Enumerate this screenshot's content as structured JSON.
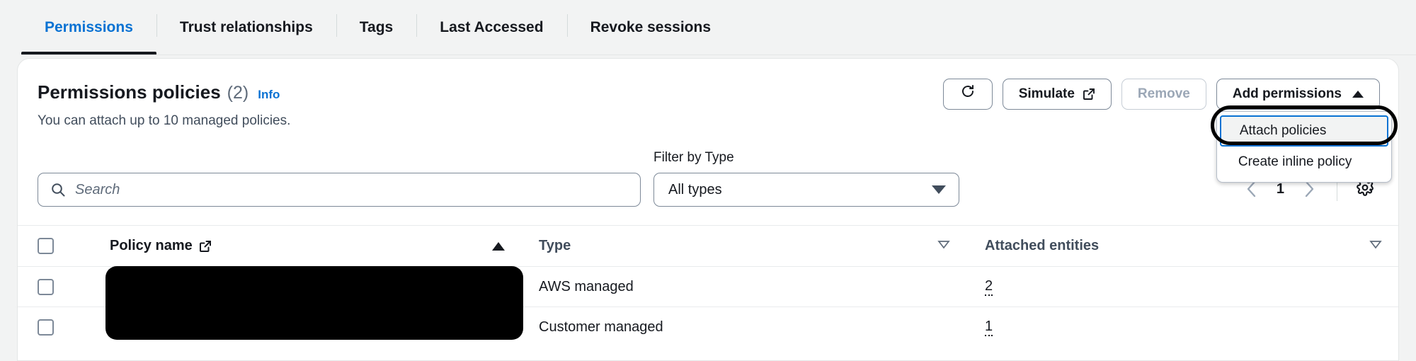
{
  "tabs": [
    {
      "label": "Permissions",
      "active": true
    },
    {
      "label": "Trust relationships",
      "active": false
    },
    {
      "label": "Tags",
      "active": false
    },
    {
      "label": "Last Accessed",
      "active": false
    },
    {
      "label": "Revoke sessions",
      "active": false
    }
  ],
  "panel": {
    "title": "Permissions policies",
    "count": "(2)",
    "info_label": "Info",
    "subtitle": "You can attach up to 10 managed policies."
  },
  "actions": {
    "refresh_icon": "refresh-icon",
    "simulate_label": "Simulate",
    "simulate_icon": "external-link-icon",
    "remove_label": "Remove",
    "add_permissions_label": "Add permissions",
    "add_permissions_caret": "caret-up-icon"
  },
  "dropdown": {
    "items": [
      {
        "label": "Attach policies",
        "selected": true
      },
      {
        "label": "Create inline policy",
        "selected": false
      }
    ]
  },
  "filters": {
    "search_placeholder": "Search",
    "search_value": "",
    "search_icon": "search-icon",
    "type_label": "Filter by Type",
    "type_value": "All types",
    "type_options": [
      "All types"
    ]
  },
  "pagination": {
    "prev_icon": "chevron-left-icon",
    "page": "1",
    "next_icon": "chevron-right-icon",
    "settings_icon": "gear-icon"
  },
  "table": {
    "columns": [
      {
        "label": "Policy name",
        "icon": "external-link-icon",
        "sort": "asc"
      },
      {
        "label": "Type",
        "icon": "",
        "sort": "none"
      },
      {
        "label": "Attached entities",
        "icon": "",
        "sort": "none"
      }
    ],
    "rows": [
      {
        "policy_name": "",
        "redacted": true,
        "type": "AWS managed",
        "attached_entities": "2"
      },
      {
        "policy_name": "",
        "redacted": true,
        "type": "Customer managed",
        "attached_entities": "1"
      }
    ]
  },
  "colors": {
    "accent_blue": "#0972d3",
    "text_dark": "#16191f",
    "text_muted": "#5f6b7a",
    "border": "#e4e6e6",
    "page_bg": "#f2f3f3",
    "redaction": "#000000"
  }
}
